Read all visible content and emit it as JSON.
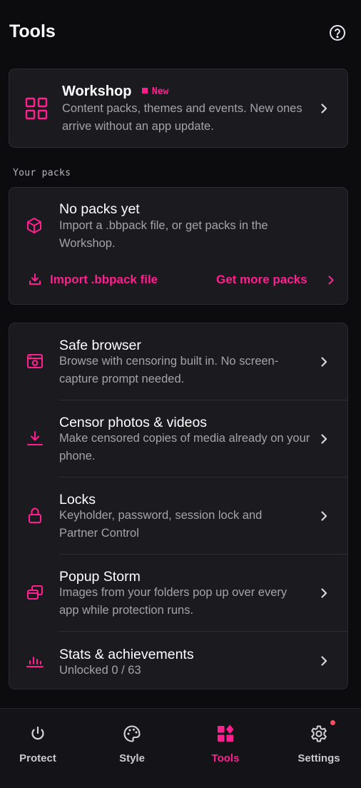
{
  "header": {
    "title": "Tools",
    "help_icon": "help-circle-icon"
  },
  "workshop": {
    "title": "Workshop",
    "badge": "New",
    "description": "Content packs, themes and events. New ones arrive without an app update.",
    "icon": "grid-icon"
  },
  "packs": {
    "section_label": "Your packs",
    "empty_title": "No packs yet",
    "empty_description": "Import a .bbpack file, or get packs in the Workshop.",
    "import_label": "Import .bbpack file",
    "get_more_label": "Get more packs",
    "icon": "package-icon"
  },
  "tools": [
    {
      "title": "Safe browser",
      "description": "Browse with censoring built in. No screen-capture prompt needed.",
      "icon": "browser-icon"
    },
    {
      "title": "Censor photos & videos",
      "description": "Make censored copies of media already on your phone.",
      "icon": "download-icon"
    },
    {
      "title": "Locks",
      "description": "Keyholder, password, session lock and Partner Control",
      "icon": "lock-icon"
    },
    {
      "title": "Popup Storm",
      "description": "Images from your folders pop up over every app while protection runs.",
      "icon": "windows-icon"
    },
    {
      "title": "Stats & achievements",
      "description": "Unlocked 0 / 63",
      "icon": "bar-chart-icon"
    }
  ],
  "nav": {
    "items": [
      {
        "label": "Protect",
        "icon": "power-icon"
      },
      {
        "label": "Style",
        "icon": "palette-icon"
      },
      {
        "label": "Tools",
        "icon": "tools-icon"
      },
      {
        "label": "Settings",
        "icon": "gear-icon"
      }
    ],
    "active": "Tools"
  },
  "colors": {
    "accent": "#ff1f8f",
    "background": "#0c0c0f",
    "card": "#1a1a1f",
    "notification": "#ff4d5e"
  }
}
